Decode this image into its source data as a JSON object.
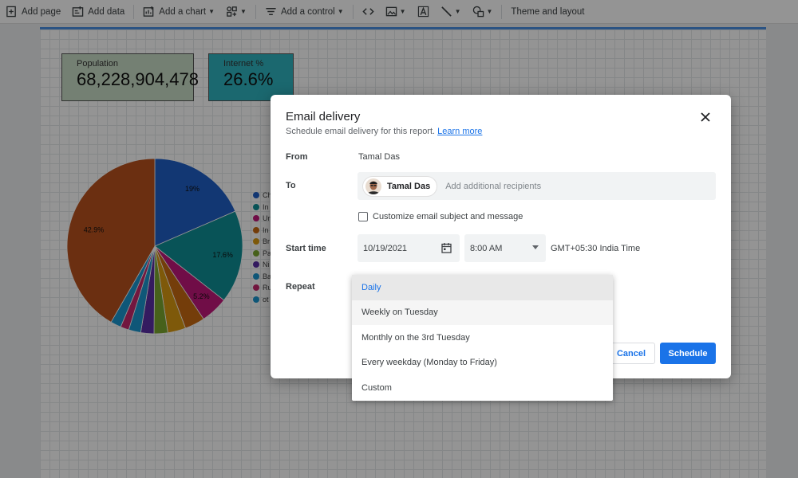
{
  "toolbar": {
    "add_page": "Add page",
    "add_data": "Add data",
    "add_chart": "Add a chart",
    "add_control": "Add a control",
    "theme": "Theme and layout"
  },
  "scorecards": [
    {
      "label": "Population",
      "value": "68,228,904,478"
    },
    {
      "label": "Internet %",
      "value": "26.6%"
    }
  ],
  "chart_data": {
    "type": "pie",
    "slice_labels": [
      "19%",
      "17.6%",
      "5.2%",
      "42.9%"
    ],
    "values": [
      19.0,
      17.6,
      5.2,
      3.8,
      3.4,
      2.6,
      2.5,
      2.3,
      1.6,
      2.0,
      42.9
    ],
    "colors": [
      "#1f5fc6",
      "#0f8f97",
      "#c2177a",
      "#c96a12",
      "#d99a12",
      "#7aa830",
      "#5a2fa5",
      "#1b96cf",
      "#c4296d",
      "#1b96cf",
      "#b8511e"
    ],
    "legend": [
      "Ch",
      "In",
      "Ur",
      "In",
      "Br",
      "Pa",
      "Ni",
      "Ba",
      "Ru",
      "ot"
    ]
  },
  "dialog": {
    "title": "Email delivery",
    "subtitle": "Schedule email delivery for this report.",
    "learn_more": "Learn more",
    "from_label": "From",
    "from_value": "Tamal Das",
    "to_label": "To",
    "to_chip": "Tamal Das",
    "to_placeholder": "Add additional recipients",
    "customize": "Customize email subject and message",
    "start_label": "Start time",
    "date": "10/19/2021",
    "time": "8:00 AM",
    "timezone": "GMT+05:30 India Time",
    "repeat_label": "Repeat",
    "cancel": "Cancel",
    "schedule": "Schedule"
  },
  "repeat_menu": {
    "options": [
      "Daily",
      "Weekly on Tuesday",
      "Monthly on the 3rd Tuesday",
      "Every weekday (Monday to Friday)",
      "Custom"
    ],
    "selected": "Daily"
  },
  "colors": {
    "accent": "#1a73e8",
    "page_border": "#4a90e2"
  }
}
